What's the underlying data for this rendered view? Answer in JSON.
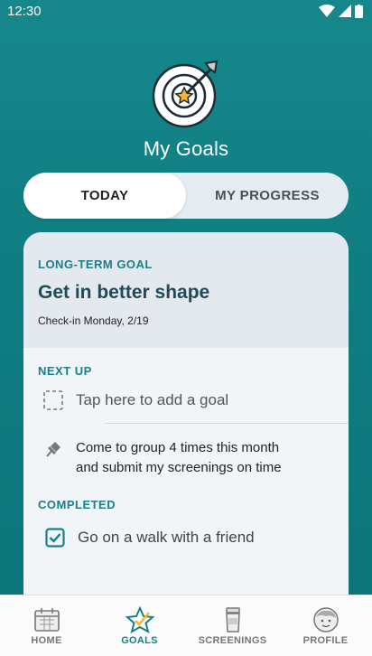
{
  "status_bar": {
    "time": "12:30"
  },
  "header": {
    "title": "My Goals",
    "emblem_icon": "target-arrow-icon"
  },
  "tabs": [
    {
      "label": "TODAY",
      "active": true
    },
    {
      "label": "MY PROGRESS",
      "active": false
    }
  ],
  "long_term_goal": {
    "eyebrow": "LONG-TERM GOAL",
    "title": "Get in better shape",
    "checkin": "Check-in Monday, 2/19"
  },
  "next_up": {
    "header": "NEXT UP",
    "add_goal_label": "Tap here to add a goal",
    "pinned_goal": "Come to group 4 times this month and submit my screenings on time"
  },
  "completed": {
    "header": "COMPLETED",
    "items": [
      "Go on a walk with a friend"
    ]
  },
  "bottom_nav": [
    {
      "label": "HOME",
      "icon": "calendar-icon",
      "active": false
    },
    {
      "label": "GOALS",
      "icon": "star-icon",
      "active": true
    },
    {
      "label": "SCREENINGS",
      "icon": "specimen-cup-icon",
      "active": false
    },
    {
      "label": "PROFILE",
      "icon": "profile-face-icon",
      "active": false
    }
  ],
  "colors": {
    "accent": "#15808a",
    "header_bg": "#127f84",
    "title_text": "#1f4b57"
  }
}
